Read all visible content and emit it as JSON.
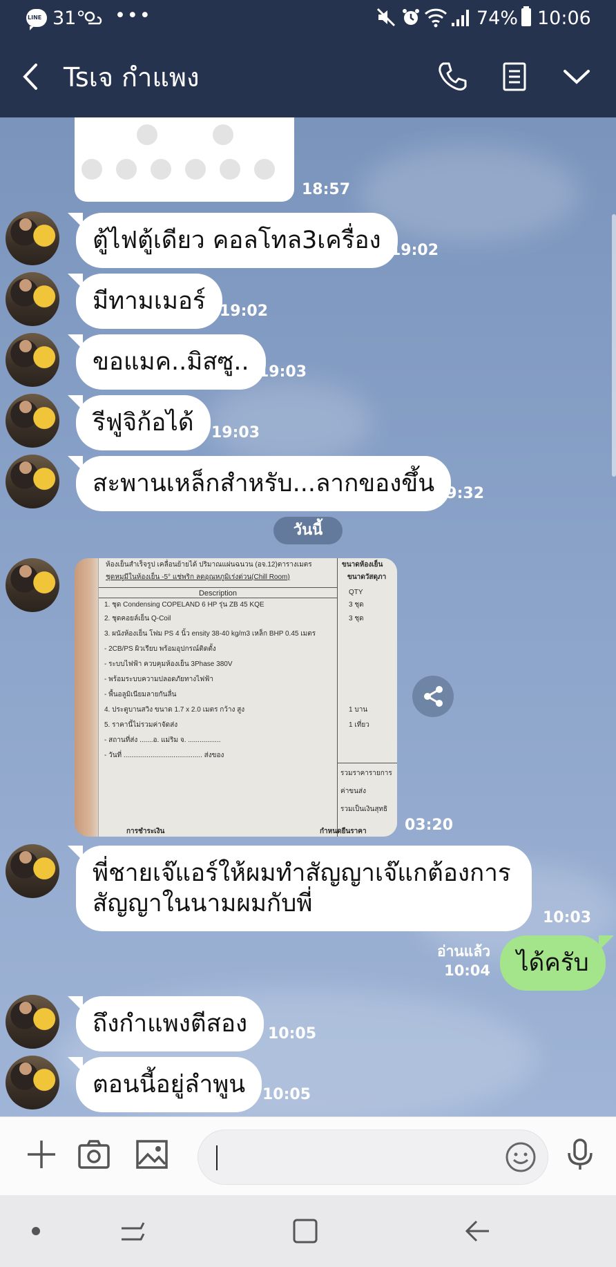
{
  "status_bar": {
    "line_badge": "LINE",
    "temperature": "31°",
    "more": "•••",
    "battery": "74%",
    "time": "10:06"
  },
  "header": {
    "title": "Tsเจ กำแพง",
    "back_icon": "chevron-left-icon",
    "call_icon": "phone-icon",
    "notes_icon": "notes-icon",
    "menu_icon": "chevron-down-icon"
  },
  "messages": [
    {
      "type": "image",
      "time": "18:57"
    },
    {
      "type": "text",
      "from": "them",
      "text": "ตู้ไฟตู้เดียว คอลโทล3เครื่อง",
      "time": "19:02"
    },
    {
      "type": "text",
      "from": "them",
      "text": "มีทามเมอร์",
      "time": "19:02"
    },
    {
      "type": "text",
      "from": "them",
      "text": "ขอแมค..มิสซู..",
      "time": "19:03"
    },
    {
      "type": "text",
      "from": "them",
      "text": "รีฟูจิก้อได้",
      "time": "19:03"
    },
    {
      "type": "text",
      "from": "them",
      "text": "สะพานเหล็กสำหรับ...ลากของขึ้น",
      "time": "19:32"
    },
    {
      "type": "date",
      "text": "วันนี้"
    },
    {
      "type": "photo",
      "from": "them",
      "time": "03:20"
    },
    {
      "type": "text",
      "from": "them",
      "lines": [
        "พี่ชายเจ๊แอร์ให้ผมทำสัญญาเจ๊แกต้องการ",
        "สัญญาในนามผมกับพี่"
      ],
      "time": "10:03"
    },
    {
      "type": "text",
      "from": "me",
      "text": "ได้ครับ",
      "read": "อ่านแล้ว",
      "time": "10:04"
    },
    {
      "type": "text",
      "from": "them",
      "text": "ถึงกำแพงตีสอง",
      "time": "10:05"
    },
    {
      "type": "text",
      "from": "them",
      "text": "ตอนนี้อยู่ลำพูน",
      "time": "10:05"
    }
  ],
  "photo_doc": {
    "header": "Description",
    "qty_header": "QTY",
    "lines": [
      "ห้องเย็นสำเร็จรูป  เคลื่อนย้ายได้  ปริมาณแผ่นฉนวน (อจ.12)ตารางเมตร",
      "ชุดหมูมีในห้องเย็น  -5°  แช่พริก ลดอุณหภูมิเร่งด่วน(Chill Room)",
      "1.  ชุด Condensing COPELAND 6 HP รุ่น ZB 45 KQE",
      "2.  ชุดคอยล์เย็น  Q-Coil",
      "3.  ผนังห้องเย็น โฟม PS 4  นิ้ว ensity 38-40 kg/m3  เหล็ก BHP 0.45 เมตร",
      "   - 2CB/PS  ผิวเรียบ  พร้อมอุปกรณ์ติดตั้ง",
      "   - ระบบไฟฟ้า  ควบคุมห้องเย็น  3Phase 380V",
      "   - พร้อมระบบความปลอดภัยทางไฟฟ้า",
      "   - พื้นอลูมิเนียมลายกันลื่น",
      "4.  ประตูบานสวิง  ขนาด  1.7 x 2.0 เมตร  กว้าง สูง",
      "5.  ราคานี้ไม่รวมค่าจัดส่ง",
      "   - สถานที่ส่ง .......อ. แม่ริม จ. .................",
      "   - วันที่ .........................................  ส่งของ"
    ],
    "qty": [
      "3  ชุด",
      "3  ชุด",
      "",
      "",
      "",
      "",
      "",
      "1 บาน",
      "1 เที่ยว"
    ],
    "right_top": [
      "ขนาดห้องเย็น",
      "ขนาดวัสดุภา"
    ],
    "right_bottom": [
      "รวมราคารายการ",
      "ค่าขนส่ง",
      "รวมเป็นเงินสุทธิ"
    ],
    "footer_left": "การชำระเงิน",
    "footer_right": "กำหนดยืนราคา"
  },
  "input_bar": {
    "placeholder": "",
    "icons": [
      "plus-icon",
      "camera-icon",
      "image-icon",
      "emoji-icon",
      "mic-icon"
    ]
  },
  "nav_bar": {
    "icons": [
      "dot-icon",
      "recent-apps-icon",
      "home-icon",
      "back-icon"
    ]
  },
  "colors": {
    "header_bg": "#26334f",
    "chat_bg": "#7c98c1",
    "bubble_in": "#ffffff",
    "bubble_out": "#a4e48a"
  }
}
